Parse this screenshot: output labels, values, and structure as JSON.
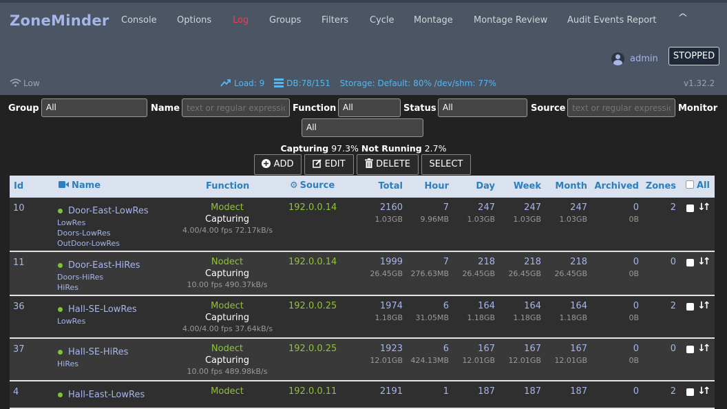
{
  "app": {
    "brand": "ZoneMinder"
  },
  "nav": {
    "items": [
      "Console",
      "Options",
      "Log",
      "Groups",
      "Filters",
      "Cycle",
      "Montage",
      "Montage Review",
      "Audit Events Report"
    ],
    "active": "Log",
    "collapse_glyph": "^"
  },
  "user": {
    "name": "admin",
    "icon": "user-circle-icon"
  },
  "state_button": "STOPPED",
  "status": {
    "bandwidth": "Low",
    "load": "Load: 9",
    "db": "DB:78/151",
    "storage": "Storage: Default: 80% /dev/shm: 77%",
    "version": "v1.32.2"
  },
  "filters": {
    "group_label": "Group",
    "group_value": "All",
    "name_label": "Name",
    "name_placeholder": "text or regular expression",
    "function_label": "Function",
    "function_value": "All",
    "status_label": "Status",
    "status_value": "All",
    "source_label": "Source",
    "source_placeholder": "text or regular expression",
    "monitor_label": "Monitor",
    "monitor_value": "All"
  },
  "summary": {
    "capturing_label": "Capturing",
    "capturing_value": "97.3%",
    "notrunning_label": "Not Running",
    "notrunning_value": "2.7%"
  },
  "actions": {
    "add": "ADD",
    "edit": "EDIT",
    "delete": "DELETE",
    "select": "SELECT"
  },
  "columns": {
    "id": "Id",
    "name": "Name",
    "function": "Function",
    "source": "Source",
    "total": "Total",
    "hour": "Hour",
    "day": "Day",
    "week": "Week",
    "month": "Month",
    "archived": "Archived",
    "zones": "Zones",
    "all": "All"
  },
  "colors": {
    "header_bg": "#4b5563",
    "accent": "#56b6f0",
    "link": "#a6b6e8",
    "active": "#f03c53",
    "ok_green": "#8fc43a",
    "table_head": "#dbe2ef"
  },
  "monitors": [
    {
      "id": "10",
      "name": "Door-East-LowRes",
      "groups": [
        "LowRes",
        "Doors-LowRes",
        "OutDoor-LowRes"
      ],
      "function": "Modect",
      "state": "Capturing",
      "fps": "4.00/4.00 fps 72.17kB/s",
      "source": "192.0.0.14",
      "total": "2160",
      "total_size": "1.03GB",
      "hour": "7",
      "hour_size": "9.96MB",
      "day": "247",
      "day_size": "1.03GB",
      "week": "247",
      "week_size": "1.03GB",
      "month": "247",
      "month_size": "1.03GB",
      "archived": "0",
      "archived_size": "0B",
      "zones": "2"
    },
    {
      "id": "11",
      "name": "Door-East-HiRes",
      "groups": [
        "Doors-HiRes",
        "HiRes"
      ],
      "function": "Nodect",
      "state": "Capturing",
      "fps": "10.00 fps 490.37kB/s",
      "source": "192.0.0.14",
      "total": "1999",
      "total_size": "26.45GB",
      "hour": "7",
      "hour_size": "276.63MB",
      "day": "218",
      "day_size": "26.45GB",
      "week": "218",
      "week_size": "26.45GB",
      "month": "218",
      "month_size": "26.45GB",
      "archived": "0",
      "archived_size": "0B",
      "zones": "0"
    },
    {
      "id": "36",
      "name": "Hall-SE-LowRes",
      "groups": [
        "LowRes"
      ],
      "function": "Modect",
      "state": "Capturing",
      "fps": "4.00/4.00 fps 37.64kB/s",
      "source": "192.0.0.25",
      "total": "1974",
      "total_size": "1.18GB",
      "hour": "6",
      "hour_size": "31.05MB",
      "day": "164",
      "day_size": "1.18GB",
      "week": "164",
      "week_size": "1.18GB",
      "month": "164",
      "month_size": "1.18GB",
      "archived": "0",
      "archived_size": "0B",
      "zones": "2"
    },
    {
      "id": "37",
      "name": "Hall-SE-HiRes",
      "groups": [
        "HiRes"
      ],
      "function": "Nodect",
      "state": "Capturing",
      "fps": "10.00 fps 489.98kB/s",
      "source": "192.0.0.25",
      "total": "1923",
      "total_size": "12.01GB",
      "hour": "6",
      "hour_size": "424.13MB",
      "day": "167",
      "day_size": "12.01GB",
      "week": "167",
      "week_size": "12.01GB",
      "month": "167",
      "month_size": "12.01GB",
      "archived": "0",
      "archived_size": "0B",
      "zones": "0"
    },
    {
      "id": "4",
      "name": "Hall-East-LowRes",
      "groups": [],
      "function": "Modect",
      "state": "",
      "fps": "",
      "source": "192.0.0.11",
      "total": "2191",
      "total_size": "",
      "hour": "1",
      "hour_size": "",
      "day": "187",
      "day_size": "",
      "week": "187",
      "week_size": "",
      "month": "187",
      "month_size": "",
      "archived": "0",
      "archived_size": "",
      "zones": "2"
    }
  ]
}
